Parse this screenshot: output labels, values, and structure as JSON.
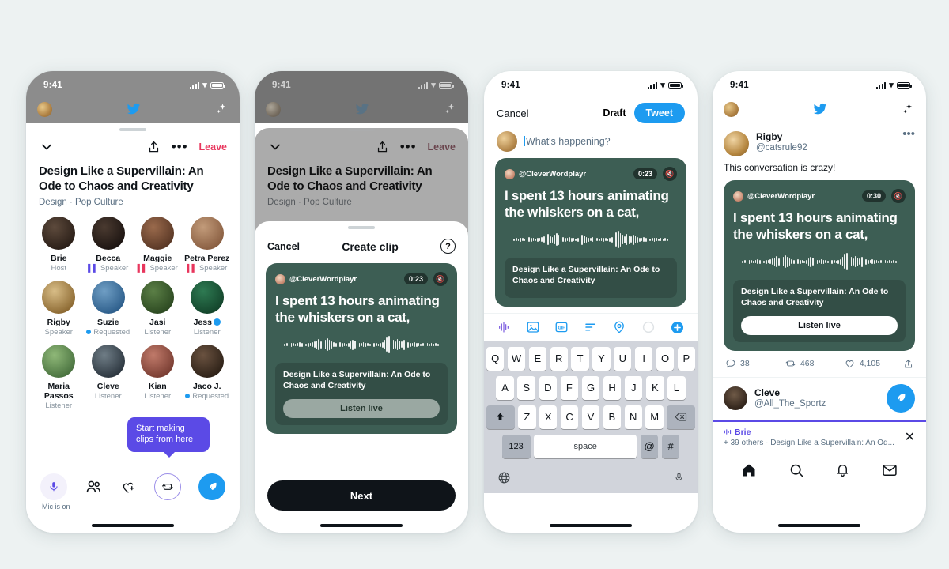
{
  "background_color": "#edf2f2",
  "accent": {
    "twitter_blue": "#1d9bf0",
    "purple": "#5b4ae6",
    "leave_red": "#e8365d",
    "clip_green": "#3d5e54"
  },
  "status_bar": {
    "time": "9:41",
    "signal_icon": "cellular-bars-icon",
    "wifi_icon": "wifi-icon",
    "battery_icon": "battery-icon"
  },
  "screen1": {
    "nav": {
      "avatar": "profile-avatar",
      "logo": "twitter-bird-icon",
      "sparkle": "sparkle-icon"
    },
    "sheet_header": {
      "collapse_icon": "chevron-down-icon",
      "share_icon": "share-icon",
      "more_icon": "more-dots-icon",
      "leave_label": "Leave"
    },
    "room": {
      "title": "Design Like a Supervillain: An Ode to Chaos and Creativity",
      "subtitle": "Design · Pop Culture"
    },
    "participants": [
      {
        "name": "Brie",
        "role": "Host",
        "badge": "none",
        "verified": false
      },
      {
        "name": "Becca",
        "role": "Speaker",
        "badge": "mic-purple",
        "verified": false
      },
      {
        "name": "Maggie",
        "role": "Speaker",
        "badge": "mic-pink",
        "verified": false
      },
      {
        "name": "Petra Perez",
        "role": "Speaker",
        "badge": "mic-pink",
        "verified": false
      },
      {
        "name": "Rigby",
        "role": "Speaker",
        "badge": "none",
        "verified": false
      },
      {
        "name": "Suzie",
        "role": "Requested",
        "badge": "dot-blue",
        "verified": false
      },
      {
        "name": "Jasi",
        "role": "Listener",
        "badge": "none",
        "verified": false
      },
      {
        "name": "Jess",
        "role": "Listener",
        "badge": "none",
        "verified": true
      },
      {
        "name": "Maria Passos",
        "role": "Listener",
        "badge": "none",
        "verified": false
      },
      {
        "name": "Cleve",
        "role": "Listener",
        "badge": "none",
        "verified": false
      },
      {
        "name": "Kian",
        "role": "Listener",
        "badge": "none",
        "verified": false
      },
      {
        "name": "Jaco J.",
        "role": "Requested",
        "badge": "dot-blue",
        "verified": false
      }
    ],
    "tooltip": "Start making clips from here",
    "action_bar": {
      "mic_icon": "microphone-icon",
      "mic_caption": "Mic is on",
      "people_icon": "people-icon",
      "heart_icon": "heart-plus-icon",
      "clip_icon": "clip-repeat-icon",
      "compose_icon": "compose-quill-icon"
    }
  },
  "screen2": {
    "modal": {
      "cancel_label": "Cancel",
      "title": "Create clip",
      "help_icon": "question-mark-icon"
    },
    "clip": {
      "handle": "@CleverWordplayr",
      "duration": "0:23",
      "mute_icon": "speaker-muted-icon",
      "quote": "I spent 13 hours animating the whiskers on a cat,",
      "footer_title": "Design Like a Supervillain: An Ode to Chaos and Creativity",
      "listen_label": "Listen live"
    },
    "next_label": "Next"
  },
  "screen3": {
    "compose": {
      "cancel_label": "Cancel",
      "draft_label": "Draft",
      "tweet_label": "Tweet",
      "placeholder": "What's happening?"
    },
    "clip": {
      "handle": "@CleverWordplayr",
      "duration": "0:23",
      "mute_icon": "speaker-muted-icon",
      "quote": "I spent 13 hours animating the whiskers on a cat,",
      "footer_title": "Design Like a Supervillain: An Ode to Chaos and Creativity"
    },
    "toolbar_icons": [
      "audio-waveform-icon",
      "image-icon",
      "gif-icon",
      "poll-icon",
      "location-icon",
      "character-count-icon",
      "add-tweet-icon"
    ],
    "keyboard": {
      "row1": [
        "Q",
        "W",
        "E",
        "R",
        "T",
        "Y",
        "U",
        "I",
        "O",
        "P"
      ],
      "row2": [
        "A",
        "S",
        "D",
        "F",
        "G",
        "H",
        "J",
        "K",
        "L"
      ],
      "row3": [
        "Z",
        "X",
        "C",
        "V",
        "B",
        "N",
        "M"
      ],
      "shift_icon": "shift-icon",
      "backspace_icon": "backspace-icon",
      "numbers_label": "123",
      "space_label": "space",
      "at_label": "@",
      "hash_label": "#",
      "globe_icon": "globe-icon",
      "dictation_icon": "microphone-icon"
    }
  },
  "screen4": {
    "nav": {
      "avatar": "profile-avatar",
      "logo": "twitter-bird-icon",
      "sparkle": "sparkle-icon"
    },
    "tweet": {
      "name": "Rigby",
      "handle": "@catsrule92",
      "more_icon": "more-dots-icon",
      "body": "This conversation is crazy!"
    },
    "clip": {
      "handle": "@CleverWordplayr",
      "duration": "0:30",
      "mute_icon": "speaker-muted-icon",
      "quote": "I spent 13 hours animating the whiskers on a cat,",
      "footer_title": "Design Like a Supervillain: An Ode to Chaos and Creativity",
      "listen_label": "Listen live"
    },
    "stats": {
      "replies": "38",
      "retweets": "468",
      "likes": "4,105",
      "share_icon": "share-icon"
    },
    "next_tweet": {
      "name": "Cleve",
      "handle": "@All_The_Sportz",
      "fab_icon": "compose-quill-icon"
    },
    "live_bar": {
      "speaker": "Brie",
      "detail": "+ 39 others · Design Like a Supervillain: An Od...",
      "close_icon": "close-icon",
      "audio_icon": "audio-wave-icon"
    },
    "tabs": [
      "home-icon",
      "search-icon",
      "notifications-icon",
      "messages-icon"
    ]
  }
}
